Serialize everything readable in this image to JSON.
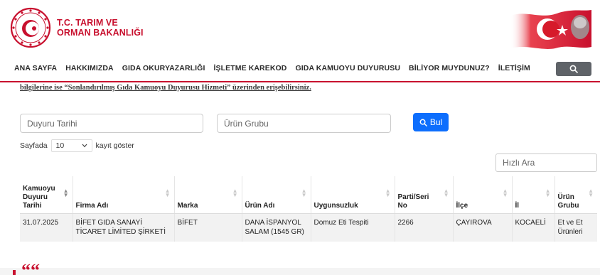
{
  "header": {
    "brand_line1": "T.C. TARIM VE",
    "brand_line2": "ORMAN BAKANLIĞI",
    "colors": {
      "brand_red": "#c8102e"
    }
  },
  "nav": {
    "items": [
      "ANA SAYFA",
      "HAKKIMIZDA",
      "GIDA OKURYAZARLIĞI",
      "İŞLETME KAREKOD",
      "GIDA KAMUOYU DUYURUSU",
      "BİLİYOR MUYDUNUZ?",
      "İLETİŞİM"
    ],
    "search_icon": "search-icon"
  },
  "notice": "bilgilerine ise “Sonlandırılmış Gıda Kamuoyu Duyurusu Hizmeti” üzerinden erişebilirsiniz.",
  "filters": {
    "date_placeholder": "Duyuru Tarihi",
    "group_placeholder": "Ürün Grubu",
    "search_button": "Bul"
  },
  "paging": {
    "prefix": "Sayfada",
    "selected": "10",
    "suffix": "kayıt göster"
  },
  "quick_search_placeholder": "Hızlı Ara",
  "table": {
    "columns": [
      "Kamuoyu Duyuru Tarihi",
      "Firma Adı",
      "Marka",
      "Ürün Adı",
      "Uygunsuzluk",
      "Parti/Seri No",
      "İlçe",
      "İl",
      "Ürün Grubu"
    ],
    "rows": [
      {
        "date": "31.07.2025",
        "company": "BİFET GIDA SANAYİ TİCARET LİMİTED ŞİRKETİ",
        "brand": "BİFET",
        "product": "DANA İSPANYOL SALAM (1545 GR)",
        "issue": "Domuz Eti Tespiti",
        "batch": "2266",
        "district": "ÇAYIROVA",
        "province": "KOCAELİ",
        "group": "Et ve Et Ürünleri"
      }
    ]
  },
  "footer": {
    "quote_mark": "““"
  }
}
